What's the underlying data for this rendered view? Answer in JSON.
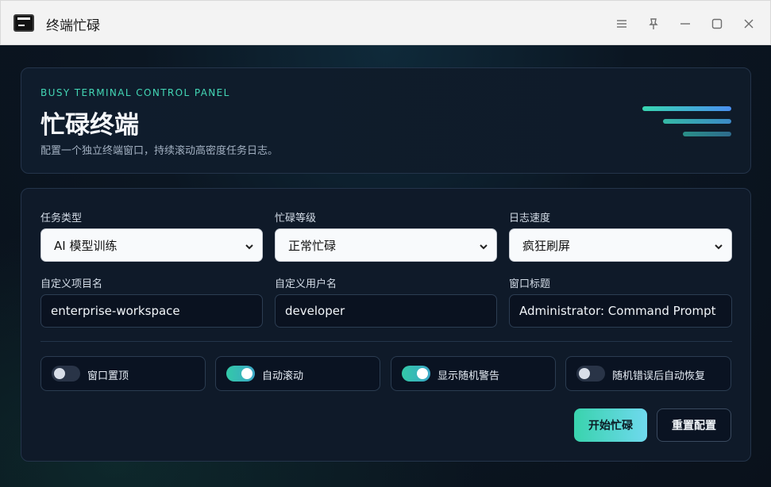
{
  "window": {
    "title": "终端忙碌",
    "controls": [
      "menu-icon",
      "pin-icon",
      "minimize-icon",
      "maximize-icon",
      "close-icon"
    ]
  },
  "hero": {
    "eyebrow": "BUSY TERMINAL CONTROL PANEL",
    "title": "忙碌终端",
    "subtitle": "配置一个独立终端窗口，持续滚动高密度任务日志。",
    "accent_gradient": [
      "#38d6b0",
      "#4a8ff0"
    ]
  },
  "form": {
    "task_type": {
      "label": "任务类型",
      "value": "AI 模型训练"
    },
    "busy_level": {
      "label": "忙碌等级",
      "value": "正常忙碌"
    },
    "log_speed": {
      "label": "日志速度",
      "value": "疯狂刷屏"
    },
    "project_name": {
      "label": "自定义项目名",
      "value": "enterprise-workspace"
    },
    "user_name": {
      "label": "自定义用户名",
      "value": "developer"
    },
    "window_title": {
      "label": "窗口标题",
      "value": "Administrator: Command Prompt"
    }
  },
  "toggles": [
    {
      "label": "窗口置顶",
      "on": false
    },
    {
      "label": "自动滚动",
      "on": true
    },
    {
      "label": "显示随机警告",
      "on": true
    },
    {
      "label": "随机错误后自动恢复",
      "on": false
    }
  ],
  "actions": {
    "start_label": "开始忙碌",
    "reset_label": "重置配置"
  },
  "colors": {
    "accent": "#39d3ad",
    "background": "#0b1220",
    "panel": "#0f1a29"
  }
}
